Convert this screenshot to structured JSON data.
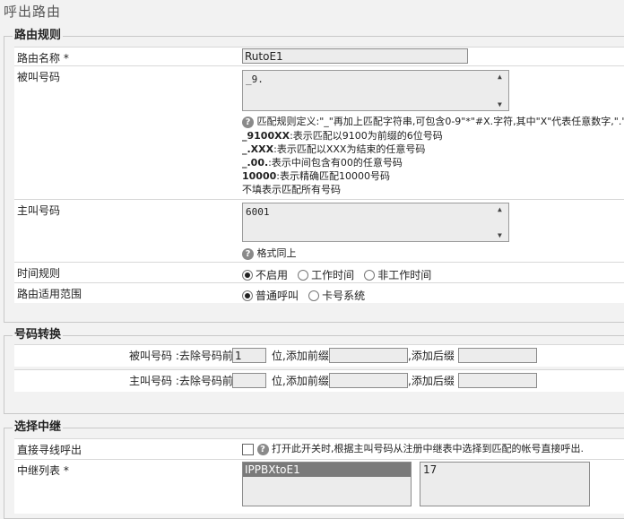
{
  "page": {
    "title": "呼出路由"
  },
  "route_rules": {
    "legend": "路由规则",
    "name_label": "路由名称",
    "required_mark": "*",
    "name_value": "RutoE1",
    "called_label": "被叫号码",
    "called_value": "_9.",
    "match_help": "匹配规则定义:\"_\"再加上匹配字符串,可包含0-9\"*\"#X.字符,其中\"X\"代表任意数字,\".\"代",
    "examples": [
      {
        "code": "_9100XX",
        "desc": ":表示匹配以9100为前缀的6位号码"
      },
      {
        "code": "_.XXX",
        "desc": ":表示匹配以XXX为结束的任意号码"
      },
      {
        "code": "_.00.",
        "desc": ":表示中间包含有00的任意号码"
      },
      {
        "code": "10000",
        "desc": ":表示精确匹配10000号码"
      }
    ],
    "empty_note": "不填表示匹配所有号码",
    "caller_label": "主叫号码",
    "caller_value": "6001",
    "format_note": "格式同上",
    "time_label": "时间规则",
    "time_options": [
      {
        "label": "不启用",
        "checked": true
      },
      {
        "label": "工作时间",
        "checked": false
      },
      {
        "label": "非工作时间",
        "checked": false
      }
    ],
    "scope_label": "路由适用范围",
    "scope_options": [
      {
        "label": "普通呼叫",
        "checked": true
      },
      {
        "label": "卡号系统",
        "checked": false
      }
    ]
  },
  "number_conversion": {
    "legend": "号码转换",
    "called_prefix_text": "被叫号码 :去除号码前",
    "called_strip_value": "1",
    "caller_prefix_text": "主叫号码 :去除号码前",
    "caller_strip_value": "",
    "digits_add_prefix": "位,添加前缀",
    "add_suffix": ",添加后缀"
  },
  "trunk": {
    "legend": "选择中继",
    "direct_label": "直接寻线呼出",
    "direct_hint": "打开此开关时,根据主叫号码从注册中继表中选择到匹配的帐号直接呼出.",
    "list_label": "中继列表",
    "required_mark": "*",
    "list_items": [
      "IPPBXtoE1"
    ],
    "right_list_items": [
      "17"
    ]
  },
  "icons": {
    "help": "help-icon"
  }
}
